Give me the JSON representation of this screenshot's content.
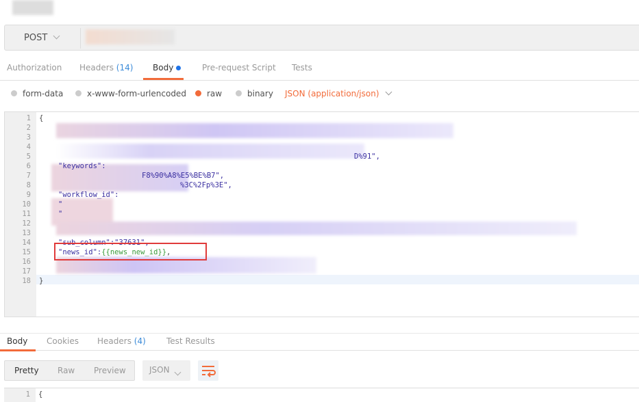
{
  "request": {
    "method": "POST"
  },
  "tabs": [
    {
      "label": "Authorization"
    },
    {
      "label": "Headers",
      "count": "(14)"
    },
    {
      "label": "Body"
    },
    {
      "label": "Pre-request Script"
    },
    {
      "label": "Tests"
    }
  ],
  "body_modes": [
    "form-data",
    "x-www-form-urlencoded",
    "raw",
    "binary"
  ],
  "selected_mode": "raw",
  "content_type": "JSON (application/json)",
  "editor": {
    "line_numbers": [
      "1",
      "2",
      "3",
      "4",
      "5",
      "6",
      "7",
      "8",
      "9",
      "10",
      "11",
      "12",
      "13",
      "14",
      "15",
      "16",
      "17",
      "18"
    ],
    "lines": {
      "l1": "{",
      "l5": "D%91\",",
      "l6": "\"keywords\":",
      "l7": "F8%90%A8%E5%BE%B7\",",
      "l8": "%3C%2Fp%3E\",",
      "l9": "\"workflow_id\":",
      "l10": "\"",
      "l11": "\"",
      "l14": "\"sub_column\":\"37631\",",
      "l15_key": "\"news_id\":",
      "l15_val": "{{news_new_id}}",
      "l15_end": ",",
      "l18": "}"
    },
    "highlight_color": "#e03a3a"
  },
  "response_tabs": [
    {
      "label": "Body"
    },
    {
      "label": "Cookies"
    },
    {
      "label": "Headers",
      "count": "(4)"
    },
    {
      "label": "Test Results"
    }
  ],
  "view_modes": [
    "Pretty",
    "Raw",
    "Preview"
  ],
  "format": "JSON",
  "response_editor": {
    "line1": "1",
    "text1": "{"
  },
  "colors": {
    "accent": "#f26b3a",
    "link": "#3b8bd9"
  }
}
